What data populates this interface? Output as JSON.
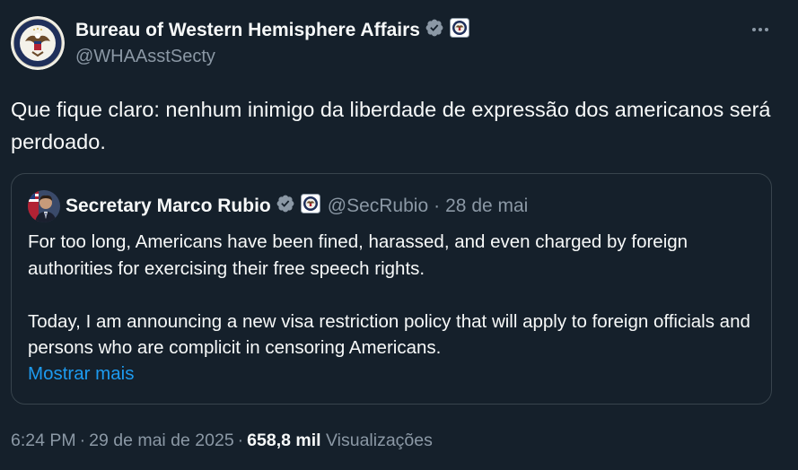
{
  "author": {
    "name": "Bureau of Western Hemisphere Affairs",
    "handle": "@WHAAsstSecty"
  },
  "post": {
    "text": "Que fique claro: nenhum inimigo da liberdade de expressão dos americanos será perdoado."
  },
  "quote": {
    "name": "Secretary Marco Rubio",
    "handle": "@SecRubio",
    "separator": "·",
    "date": "28 de mai",
    "paragraphs": [
      "For too long, Americans have been fined, harassed, and even charged by foreign authorities for exercising their free speech rights.",
      "Today, I am announcing a new visa restriction policy that will apply to foreign officials and persons who are complicit in censoring Americans."
    ],
    "show_more": "Mostrar mais"
  },
  "meta": {
    "time": "6:24 PM",
    "separator": "·",
    "date": "29 de mai de 2025",
    "views_count": "658,8 mil",
    "views_label": "Visualizações"
  },
  "colors": {
    "background": "#15202b",
    "text": "#f7f9f9",
    "secondary": "#8b98a5",
    "link": "#1d9bf0",
    "verified_badge": "#8b98a5",
    "border": "#38444d"
  },
  "icons": [
    "state-department-seal-icon",
    "verified-badge-icon",
    "affiliate-seal-icon",
    "more-options-icon"
  ]
}
